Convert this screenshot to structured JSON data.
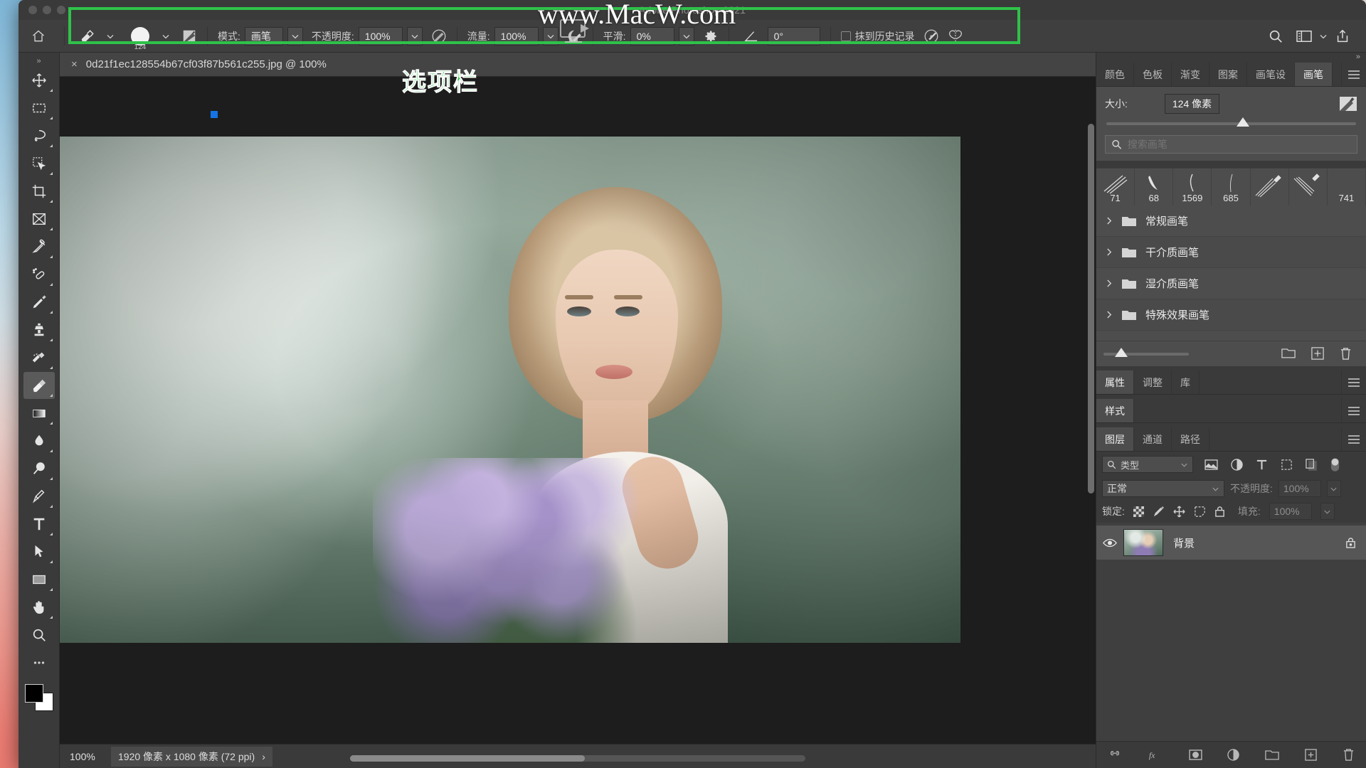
{
  "window": {
    "app_title": "Adobe Photoshop 2021",
    "traffic_lights": [
      "close",
      "minimize",
      "maximize"
    ]
  },
  "watermark": {
    "text": "www.MacW.com"
  },
  "annotation": {
    "text": "选项栏",
    "color": "#2fc24a"
  },
  "options_bar": {
    "home_icon": "home-icon",
    "tool_icon": "eraser-icon",
    "brush_size_label": "124",
    "mode": {
      "label": "模式:",
      "value": "画笔"
    },
    "opacity": {
      "label": "不透明度:",
      "value": "100%"
    },
    "flow": {
      "label": "流量:",
      "value": "100%"
    },
    "smoothing": {
      "label": "平滑:",
      "value": "0%"
    },
    "angle": {
      "value": "0°"
    },
    "erase_to_history": {
      "label": "抹到历史记录",
      "checked": false
    },
    "right_icons": [
      "search-icon",
      "workspace-icon",
      "chevron-down-icon",
      "share-icon"
    ]
  },
  "toolbar": {
    "tools": [
      {
        "name": "move-tool"
      },
      {
        "name": "marquee-tool"
      },
      {
        "name": "lasso-tool"
      },
      {
        "name": "quick-selection-tool"
      },
      {
        "name": "crop-tool"
      },
      {
        "name": "frame-tool"
      },
      {
        "name": "eyedropper-tool"
      },
      {
        "name": "healing-brush-tool"
      },
      {
        "name": "brush-tool"
      },
      {
        "name": "clone-stamp-tool"
      },
      {
        "name": "history-brush-tool"
      },
      {
        "name": "eraser-tool",
        "active": true
      },
      {
        "name": "gradient-tool"
      },
      {
        "name": "blur-tool"
      },
      {
        "name": "dodge-tool"
      },
      {
        "name": "pen-tool"
      },
      {
        "name": "type-tool"
      },
      {
        "name": "path-selection-tool"
      },
      {
        "name": "rectangle-tool"
      },
      {
        "name": "hand-tool"
      },
      {
        "name": "zoom-tool"
      },
      {
        "name": "more-tools"
      }
    ],
    "foreground_color": "#000000",
    "background_color": "#ffffff"
  },
  "document": {
    "tab_title": "0d21f1ec128554b67cf03f87b561c255.jpg @ 100%",
    "close_label": "×"
  },
  "status_bar": {
    "zoom": "100%",
    "doc_size": "1920 像素 x 1080 像素 (72 ppi)",
    "chevron": "›"
  },
  "brush_panel": {
    "tabs": [
      {
        "label": "颜色"
      },
      {
        "label": "色板"
      },
      {
        "label": "渐变"
      },
      {
        "label": "图案"
      },
      {
        "label": "画笔设"
      },
      {
        "label": "画笔",
        "active": true
      }
    ],
    "size": {
      "label": "大小:",
      "value": "124 像素"
    },
    "search_placeholder": "搜索画笔",
    "presets": [
      {
        "label": "71"
      },
      {
        "label": "68"
      },
      {
        "label": "1569"
      },
      {
        "label": "685"
      },
      {
        "label": ""
      },
      {
        "label": ""
      },
      {
        "label": "741"
      }
    ],
    "folders": [
      {
        "label": "常规画笔"
      },
      {
        "label": "干介质画笔"
      },
      {
        "label": "湿介质画笔"
      },
      {
        "label": "特殊效果画笔"
      }
    ],
    "footer_icons": [
      "new-folder-icon",
      "new-brush-icon",
      "delete-icon"
    ]
  },
  "properties_panel": {
    "tabs": [
      {
        "label": "属性",
        "active": true
      },
      {
        "label": "调整"
      },
      {
        "label": "库"
      }
    ]
  },
  "styles_panel": {
    "tabs": [
      {
        "label": "样式",
        "active": true
      }
    ]
  },
  "layers_panel": {
    "tabs": [
      {
        "label": "图层",
        "active": true
      },
      {
        "label": "通道"
      },
      {
        "label": "路径"
      }
    ],
    "filter": {
      "label": "类型",
      "icons": [
        "image-filter-icon",
        "adjustment-filter-icon",
        "text-filter-icon",
        "shape-filter-icon",
        "smart-object-filter-icon"
      ],
      "toggle": "filter-toggle"
    },
    "blend_mode": "正常",
    "opacity": {
      "label": "不透明度:",
      "value": "100%"
    },
    "lock": {
      "label": "锁定:",
      "icons": [
        "lock-transparency-icon",
        "lock-image-icon",
        "lock-position-icon",
        "lock-artboard-icon",
        "lock-all-icon"
      ]
    },
    "fill": {
      "label": "填充:",
      "value": "100%"
    },
    "layers": [
      {
        "name": "背景",
        "visible": true,
        "locked": true
      }
    ],
    "footer_icons": [
      "link-icon",
      "fx-icon",
      "mask-icon",
      "adjustment-icon",
      "group-icon",
      "new-layer-icon",
      "delete-layer-icon"
    ]
  }
}
